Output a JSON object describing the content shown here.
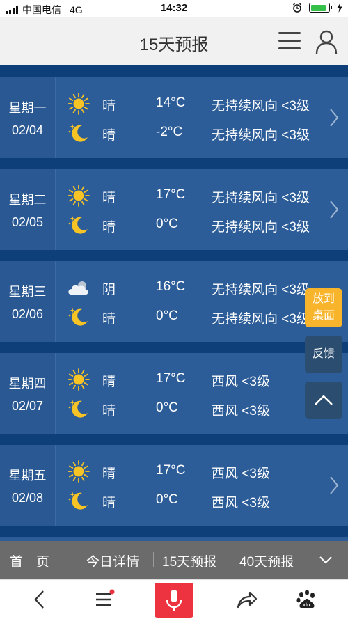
{
  "status": {
    "carrier": "中国电信",
    "network": "4G",
    "time": "14:32",
    "battery_level": 0.85
  },
  "header": {
    "title": "15天预报",
    "menu_icon": "hamburger-icon",
    "user_icon": "user-icon"
  },
  "days": [
    {
      "weekday": "星期一",
      "date": "02/04",
      "day": {
        "icon": "sun-icon",
        "cond": "晴",
        "temp": "14°C",
        "wind": "无持续风向 <3级"
      },
      "night": {
        "icon": "moon-icon",
        "cond": "晴",
        "temp": "-2°C",
        "wind": "无持续风向 <3级"
      }
    },
    {
      "weekday": "星期二",
      "date": "02/05",
      "day": {
        "icon": "sun-icon",
        "cond": "晴",
        "temp": "17°C",
        "wind": "无持续风向 <3级"
      },
      "night": {
        "icon": "moon-icon",
        "cond": "晴",
        "temp": "0°C",
        "wind": "无持续风向 <3级"
      }
    },
    {
      "weekday": "星期三",
      "date": "02/06",
      "day": {
        "icon": "cloud-icon",
        "cond": "阴",
        "temp": "16°C",
        "wind": "无持续风向 <3级"
      },
      "night": {
        "icon": "moon-icon",
        "cond": "晴",
        "temp": "0°C",
        "wind": "无持续风向 <3级"
      }
    },
    {
      "weekday": "星期四",
      "date": "02/07",
      "day": {
        "icon": "sun-icon",
        "cond": "晴",
        "temp": "17°C",
        "wind": "西风 <3级"
      },
      "night": {
        "icon": "moon-icon",
        "cond": "晴",
        "temp": "0°C",
        "wind": "西风 <3级"
      }
    },
    {
      "weekday": "星期五",
      "date": "02/08",
      "day": {
        "icon": "sun-icon",
        "cond": "晴",
        "temp": "17°C",
        "wind": "西风 <3级"
      },
      "night": {
        "icon": "moon-icon",
        "cond": "晴",
        "temp": "0°C",
        "wind": "西风 <3级"
      }
    }
  ],
  "floating": {
    "desktop_line1": "放到",
    "desktop_line2": "桌面",
    "feedback": "反馈",
    "top_icon": "chevron-up-icon"
  },
  "tabs": [
    {
      "label": "首　页"
    },
    {
      "label": "今日详情"
    },
    {
      "label": "15天预报"
    },
    {
      "label": "40天预报"
    }
  ],
  "toolbar": {
    "back_icon": "back-icon",
    "menu_icon": "menu-icon",
    "mic_icon": "microphone-icon",
    "share_icon": "share-icon",
    "baidu_icon": "baidu-paw-icon",
    "accent": "#ee3340"
  },
  "colors": {
    "card_bg": "#2c5d98",
    "page_bg": "#0f3f78",
    "sun": "#f7c325",
    "float_accent": "#f8b42a"
  }
}
